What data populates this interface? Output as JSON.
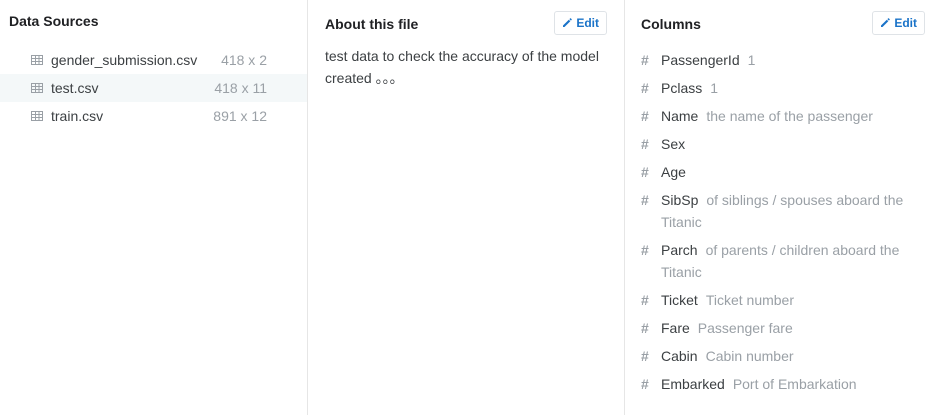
{
  "sources": {
    "title": "Data Sources",
    "files": [
      {
        "name": "gender_submission.csv",
        "dims": "418 x 2"
      },
      {
        "name": "test.csv",
        "dims": "418 x 11"
      },
      {
        "name": "train.csv",
        "dims": "891 x 12"
      }
    ],
    "active_index": 1,
    "file_icon": "table-icon"
  },
  "about": {
    "title": "About this file",
    "edit_label": "Edit",
    "text": "test data to check the accuracy of the model created 。。。"
  },
  "columns": {
    "title": "Columns",
    "edit_label": "Edit",
    "type_symbol": "#",
    "items": [
      {
        "name": "PassengerId",
        "desc": "1"
      },
      {
        "name": "Pclass",
        "desc": "1"
      },
      {
        "name": "Name",
        "desc": "the name of the passenger"
      },
      {
        "name": "Sex",
        "desc": ""
      },
      {
        "name": "Age",
        "desc": ""
      },
      {
        "name": "SibSp",
        "desc": "of siblings / spouses aboard the Titanic"
      },
      {
        "name": "Parch",
        "desc": "of parents / children aboard the Titanic"
      },
      {
        "name": "Ticket",
        "desc": "Ticket number"
      },
      {
        "name": "Fare",
        "desc": "Passenger fare"
      },
      {
        "name": "Cabin",
        "desc": "Cabin number"
      },
      {
        "name": "Embarked",
        "desc": "Port of Embarkation"
      }
    ]
  },
  "colors": {
    "accent": "#1a73c8",
    "muted": "#9aa0a6",
    "active_row": "#f4f8f9"
  }
}
